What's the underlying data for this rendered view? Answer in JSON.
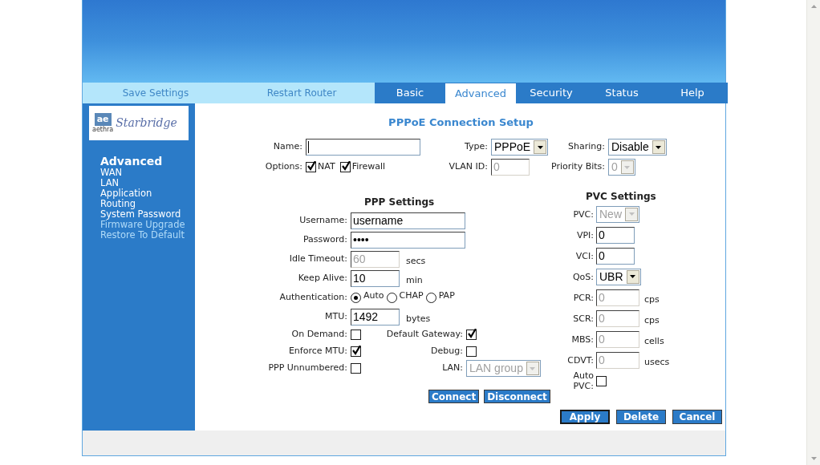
{
  "nav_links": [
    {
      "label": "Save Settings"
    },
    {
      "label": "Restart Router"
    }
  ],
  "tabs": [
    {
      "label": "Basic",
      "selected": false
    },
    {
      "label": "Advanced",
      "selected": true
    },
    {
      "label": "Security",
      "selected": false
    },
    {
      "label": "Status",
      "selected": false
    },
    {
      "label": "Help",
      "selected": false
    }
  ],
  "logo": {
    "mark": "ae",
    "brand": "aethra",
    "product": "Starbridge"
  },
  "sidebar": {
    "heading": "Advanced",
    "items": [
      {
        "label": "WAN",
        "disabled": false
      },
      {
        "label": "LAN",
        "disabled": false
      },
      {
        "label": "Application",
        "disabled": false
      },
      {
        "label": "Routing",
        "disabled": false
      },
      {
        "label": "System Password",
        "disabled": false
      },
      {
        "label": "Firmware Upgrade",
        "disabled": true
      },
      {
        "label": "Restore To Default",
        "disabled": true
      }
    ]
  },
  "title": "PPPoE Connection Setup",
  "top_rows": [
    [
      {
        "label": "Name:",
        "kind": "text",
        "disabled": false,
        "wide": true
      },
      {
        "label": "Type:",
        "kind": "select",
        "value": "PPPoE",
        "disabled": false
      },
      {
        "label": "Sharing:",
        "kind": "select",
        "value": "Disable",
        "disabled": false
      }
    ],
    [
      {
        "label": "Options:",
        "kind": "checks",
        "items": [
          {
            "label": "NAT",
            "checked": true
          },
          {
            "label": "Firewall",
            "checked": true
          }
        ]
      },
      {
        "label": "VLAN ID:",
        "kind": "text",
        "value": "0",
        "disabled": true
      },
      {
        "label": "Priority Bits:",
        "kind": "select",
        "value": "0",
        "disabled": true
      }
    ]
  ],
  "ppp": {
    "heading": "PPP Settings",
    "fields": [
      {
        "label": "Username:",
        "kind": "text",
        "value": "username",
        "disabled": false,
        "wide": true
      },
      {
        "label": "Password:",
        "kind": "text",
        "value": "••••",
        "disabled": false,
        "wide": true
      },
      {
        "label": "Idle Timeout:",
        "kind": "text",
        "value": "60",
        "disabled": true,
        "unit": "secs"
      },
      {
        "label": "Keep Alive:",
        "kind": "text",
        "value": "10",
        "disabled": false,
        "unit": "min"
      },
      {
        "label": "Authentication:",
        "kind": "radios",
        "options": [
          {
            "label": "Auto",
            "selected": true
          },
          {
            "label": "CHAP",
            "selected": false
          },
          {
            "label": "PAP",
            "selected": false
          }
        ]
      },
      {
        "label": "MTU:",
        "kind": "text",
        "value": "1492",
        "disabled": false,
        "unit": "bytes"
      }
    ],
    "pairs": [
      [
        {
          "label": "On Demand:",
          "kind": "checkbox",
          "checked": false
        },
        {
          "label": "Default Gateway:",
          "kind": "checkbox",
          "checked": true
        }
      ],
      [
        {
          "label": "Enforce MTU:",
          "kind": "checkbox",
          "checked": true
        },
        {
          "label": "Debug:",
          "kind": "checkbox",
          "checked": false
        }
      ],
      [
        {
          "label": "PPP Unnumbered:",
          "kind": "checkbox",
          "checked": false
        },
        {
          "label": "LAN:",
          "kind": "select",
          "value": "LAN group",
          "disabled": true
        }
      ]
    ],
    "buttons": [
      "Connect",
      "Disconnect"
    ]
  },
  "pvc": {
    "heading": "PVC Settings",
    "fields": [
      {
        "label": "PVC:",
        "kind": "select",
        "value": "New",
        "disabled": true
      },
      {
        "label": "VPI:",
        "kind": "text",
        "value": "0",
        "disabled": false
      },
      {
        "label": "VCI:",
        "kind": "text",
        "value": "0",
        "disabled": false
      },
      {
        "label": "QoS:",
        "kind": "select",
        "value": "UBR",
        "disabled": false
      },
      {
        "label": "PCR:",
        "kind": "text",
        "value": "0",
        "disabled": true,
        "unit": "cps"
      },
      {
        "label": "SCR:",
        "kind": "text",
        "value": "0",
        "disabled": true,
        "unit": "cps"
      },
      {
        "label": "MBS:",
        "kind": "text",
        "value": "0",
        "disabled": true,
        "unit": "cells"
      },
      {
        "label": "CDVT:",
        "kind": "text",
        "value": "0",
        "disabled": true,
        "unit": "usecs"
      },
      {
        "label": "Auto PVC:",
        "kind": "checkbox",
        "checked": false
      }
    ]
  },
  "actions": [
    {
      "label": "Apply",
      "focused": true
    },
    {
      "label": "Delete",
      "focused": false
    },
    {
      "label": "Cancel",
      "focused": false
    }
  ]
}
